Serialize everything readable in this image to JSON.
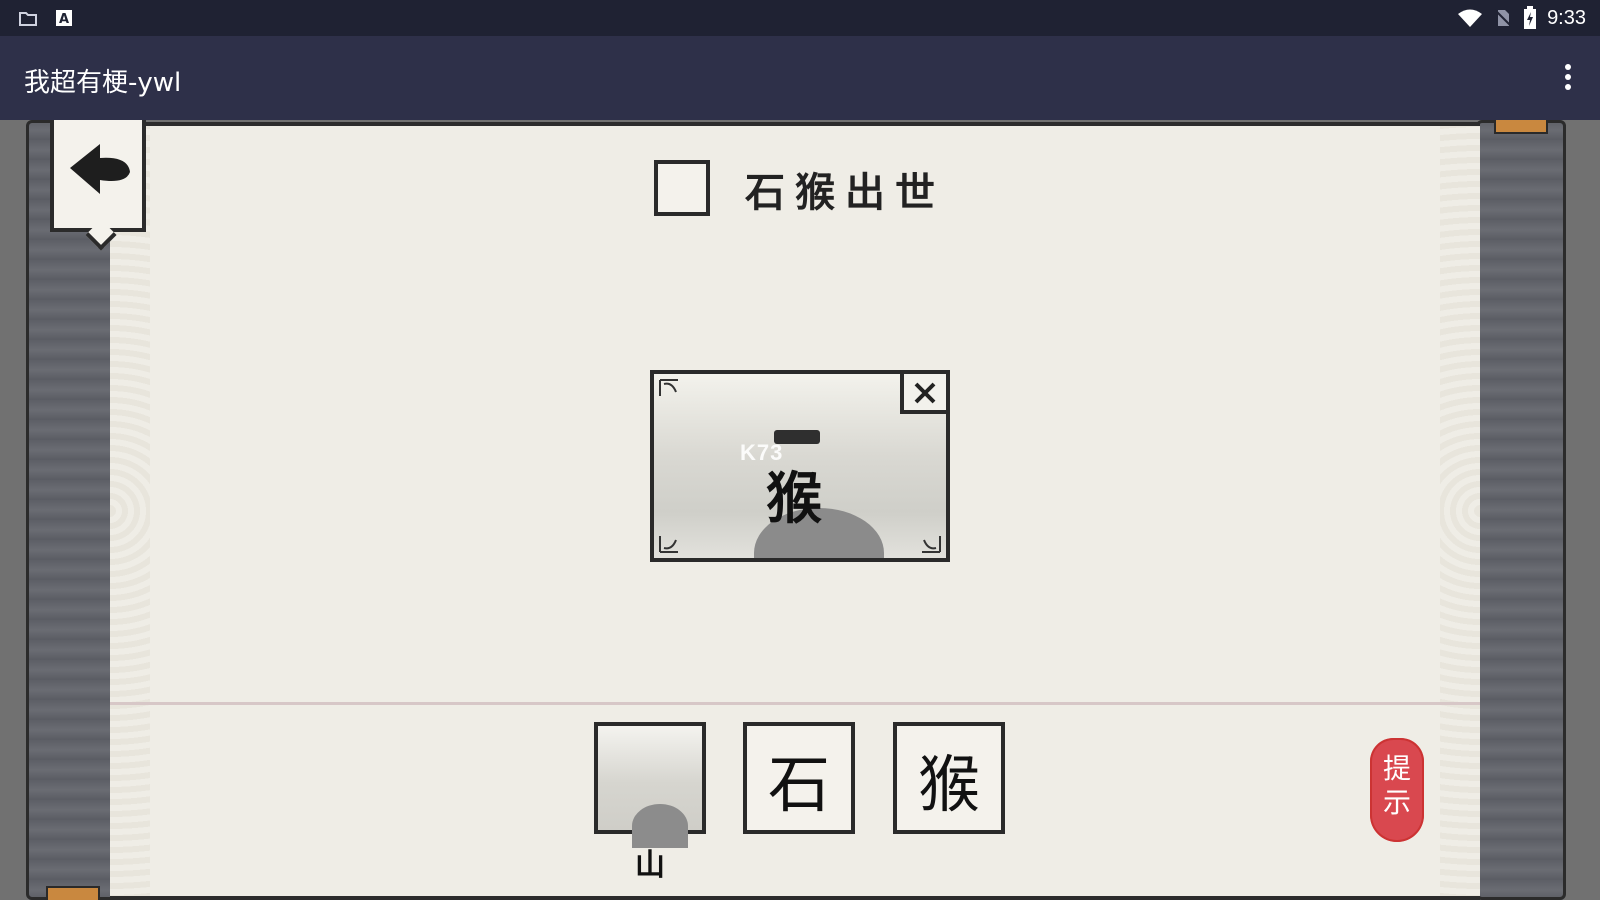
{
  "status_bar": {
    "time": "9:33"
  },
  "app_bar": {
    "title": "我超有梗-ywl"
  },
  "level": {
    "title": "石猴出世"
  },
  "card": {
    "character": "猴",
    "watermark": "K73"
  },
  "tiles": [
    {
      "character": "",
      "label": "山"
    },
    {
      "character": "石"
    },
    {
      "character": "猴"
    }
  ],
  "hint": {
    "label_top": "提",
    "label_bottom": "示"
  }
}
